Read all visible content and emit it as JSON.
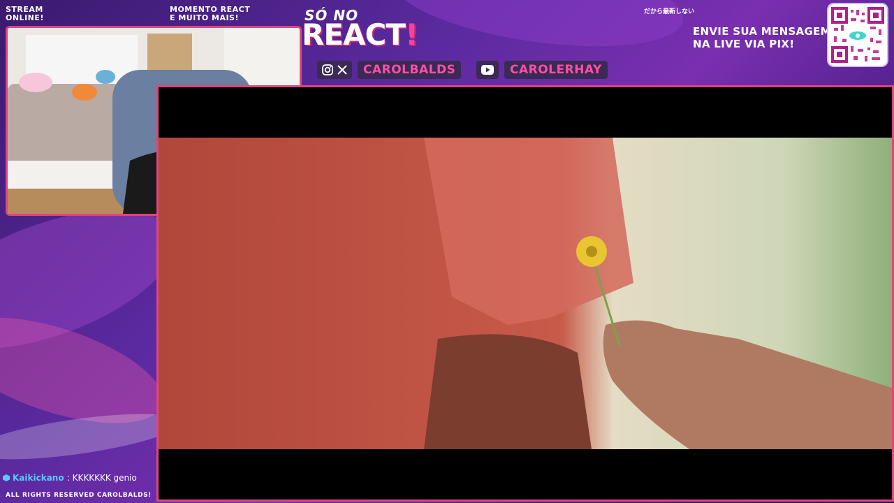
{
  "overlay": {
    "status_line1": "STREAM",
    "status_line2": "ONLINE!",
    "moment_line1": "MOMENTO REACT",
    "moment_line2": "E MUITO MAIS!",
    "title_small": "SÓ NO",
    "title_big": "REACT",
    "title_bang": "!",
    "japanese_text": "だから最新しない",
    "pix_line1": "ENVIE SUA MENSAGEM",
    "pix_line2": "NA LIVE VIA PIX!",
    "footer": "ALL RIGHTS RESERVED CAROLBALDS!"
  },
  "socials": [
    {
      "icons": [
        "instagram-icon",
        "x-icon"
      ],
      "handle": "CAROLBALDS"
    },
    {
      "icons": [
        "youtube-icon"
      ],
      "handle": "CAROLERHAY"
    }
  ],
  "chat": {
    "username": "Kaikickano",
    "separator": ":",
    "message": "KKKKKKK genio"
  },
  "colors": {
    "accent_pink": "#ff4fa3",
    "frame_border": "#e0457e",
    "chat_user": "#58c8ff",
    "bg_purple": "#5b2aa0"
  }
}
